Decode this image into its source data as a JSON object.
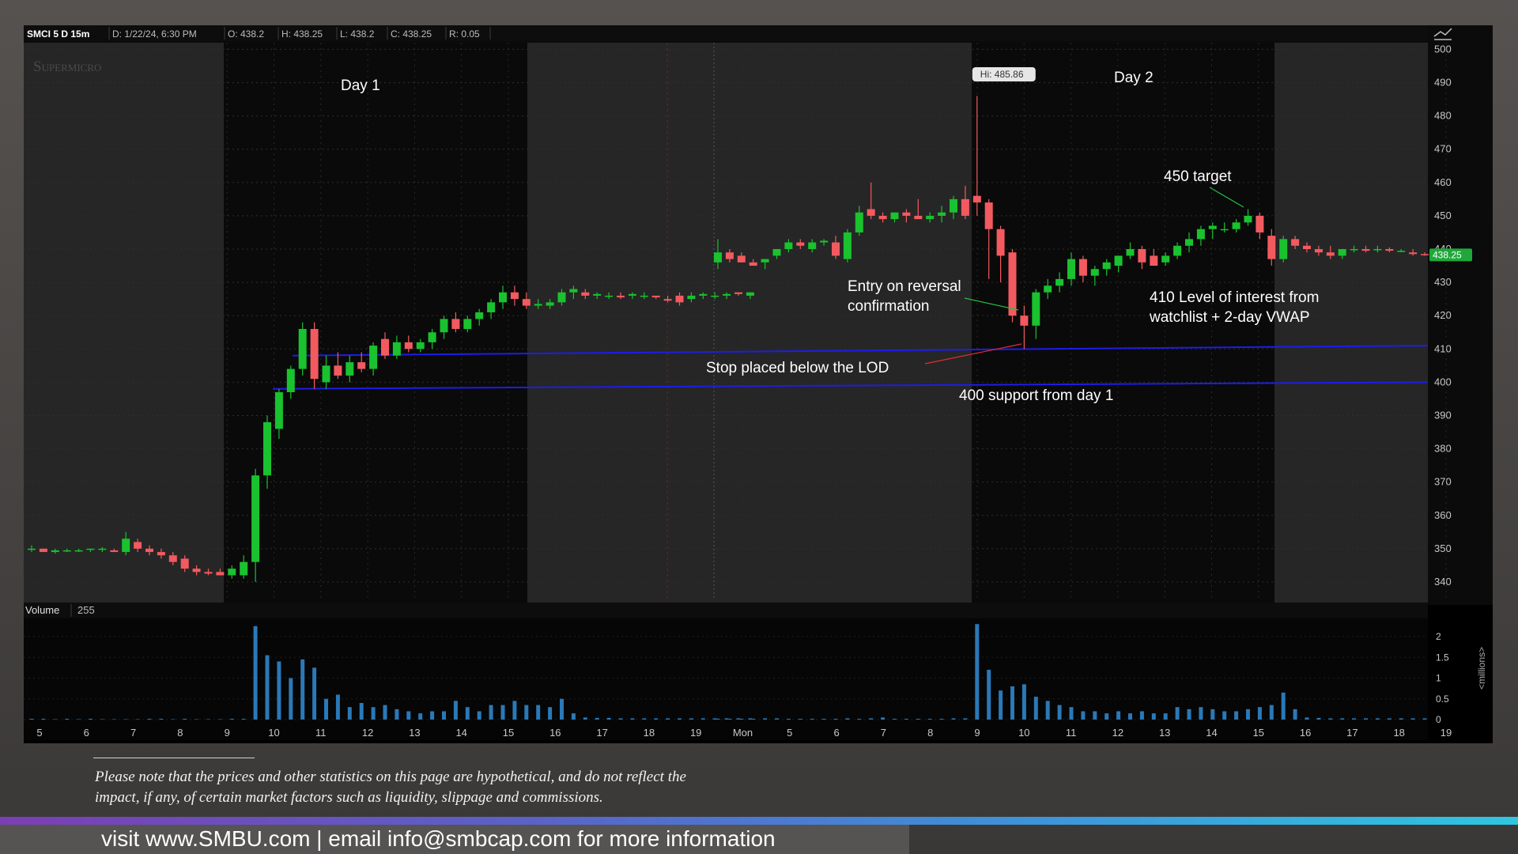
{
  "header": {
    "symbol": "SMCI 5 D 15m",
    "date": "D: 1/22/24, 6:30 PM",
    "open": "O: 438.2",
    "high": "H: 438.25",
    "low": "L: 438.2",
    "close": "C: 438.25",
    "range": "R: 0.05"
  },
  "watermark": "Supermicro",
  "volume_header": {
    "label": "Volume",
    "value": "255"
  },
  "chart_data": {
    "type": "candlestick",
    "ylim": [
      335,
      502
    ],
    "y_ticks": [
      340,
      350,
      360,
      370,
      380,
      390,
      400,
      410,
      420,
      430,
      440,
      450,
      460,
      470,
      480,
      490,
      500
    ],
    "x_ticks": [
      "5",
      "6",
      "7",
      "8",
      "9",
      "10",
      "11",
      "12",
      "13",
      "14",
      "15",
      "16",
      "17",
      "18",
      "19",
      "Mon",
      "5",
      "6",
      "7",
      "8",
      "9",
      "10",
      "11",
      "12",
      "13",
      "14",
      "15",
      "16",
      "17",
      "18",
      "19"
    ],
    "price_tag": "438.25",
    "high_tag": "Hi: 485.86",
    "hlines": [
      {
        "label": "410",
        "y_start": 408,
        "y_end": 411
      },
      {
        "label": "400",
        "y_start": 398,
        "y_end": 400
      }
    ],
    "day1": [
      {
        "o": 350,
        "h": 351,
        "l": 349,
        "c": 350
      },
      {
        "o": 350,
        "h": 350,
        "l": 349,
        "c": 349
      },
      {
        "o": 349,
        "h": 350,
        "l": 348.5,
        "c": 349.5
      },
      {
        "o": 349.5,
        "h": 350,
        "l": 349,
        "c": 349.5
      },
      {
        "o": 349.5,
        "h": 350,
        "l": 349,
        "c": 349.5
      },
      {
        "o": 350,
        "h": 350,
        "l": 349,
        "c": 350
      },
      {
        "o": 350,
        "h": 350.5,
        "l": 349,
        "c": 350
      },
      {
        "o": 349.5,
        "h": 350,
        "l": 349,
        "c": 349
      },
      {
        "o": 349,
        "h": 355,
        "l": 348,
        "c": 353
      },
      {
        "o": 352,
        "h": 353,
        "l": 349,
        "c": 350
      },
      {
        "o": 350,
        "h": 351,
        "l": 348,
        "c": 349
      },
      {
        "o": 349,
        "h": 350,
        "l": 347,
        "c": 348
      },
      {
        "o": 348,
        "h": 349,
        "l": 345,
        "c": 346
      },
      {
        "o": 347,
        "h": 348,
        "l": 343,
        "c": 344
      },
      {
        "o": 344,
        "h": 345,
        "l": 342,
        "c": 343
      },
      {
        "o": 343,
        "h": 344,
        "l": 342,
        "c": 342.5
      },
      {
        "o": 343,
        "h": 344,
        "l": 342,
        "c": 342
      },
      {
        "o": 342,
        "h": 345,
        "l": 341,
        "c": 344
      },
      {
        "o": 342,
        "h": 348,
        "l": 341,
        "c": 346
      },
      {
        "o": 346,
        "h": 374,
        "l": 340,
        "c": 372
      },
      {
        "o": 372,
        "h": 390,
        "l": 368,
        "c": 388
      },
      {
        "o": 386,
        "h": 398,
        "l": 383,
        "c": 397
      },
      {
        "o": 397,
        "h": 405,
        "l": 395,
        "c": 404
      },
      {
        "o": 404,
        "h": 418,
        "l": 402,
        "c": 416
      },
      {
        "o": 416,
        "h": 418,
        "l": 398,
        "c": 401
      },
      {
        "o": 400,
        "h": 408,
        "l": 398,
        "c": 405
      },
      {
        "o": 405,
        "h": 409,
        "l": 401,
        "c": 402
      },
      {
        "o": 402,
        "h": 408,
        "l": 400,
        "c": 406
      },
      {
        "o": 406,
        "h": 409,
        "l": 403,
        "c": 404
      },
      {
        "o": 404,
        "h": 412,
        "l": 402,
        "c": 411
      },
      {
        "o": 413,
        "h": 415,
        "l": 407,
        "c": 408
      },
      {
        "o": 408,
        "h": 414,
        "l": 407,
        "c": 412
      },
      {
        "o": 412,
        "h": 414,
        "l": 409,
        "c": 410
      },
      {
        "o": 410,
        "h": 413,
        "l": 409,
        "c": 412
      },
      {
        "o": 412,
        "h": 416,
        "l": 410,
        "c": 415
      },
      {
        "o": 415,
        "h": 420,
        "l": 413,
        "c": 419
      },
      {
        "o": 419,
        "h": 421,
        "l": 415,
        "c": 416
      },
      {
        "o": 416,
        "h": 420,
        "l": 415,
        "c": 419
      },
      {
        "o": 419,
        "h": 422,
        "l": 417,
        "c": 421
      },
      {
        "o": 421,
        "h": 425,
        "l": 419,
        "c": 424
      },
      {
        "o": 424,
        "h": 429,
        "l": 422,
        "c": 427
      },
      {
        "o": 427,
        "h": 429,
        "l": 423,
        "c": 425
      },
      {
        "o": 425,
        "h": 427,
        "l": 422,
        "c": 423
      },
      {
        "o": 423,
        "h": 425,
        "l": 422,
        "c": 423.5
      },
      {
        "o": 423,
        "h": 425,
        "l": 422,
        "c": 424
      },
      {
        "o": 424,
        "h": 428,
        "l": 423,
        "c": 427
      },
      {
        "o": 427,
        "h": 429,
        "l": 425,
        "c": 428
      },
      {
        "o": 427,
        "h": 428,
        "l": 425,
        "c": 426
      },
      {
        "o": 426,
        "h": 427,
        "l": 425,
        "c": 426.5
      },
      {
        "o": 426,
        "h": 427,
        "l": 425,
        "c": 426
      },
      {
        "o": 426,
        "h": 427,
        "l": 425,
        "c": 425.5
      },
      {
        "o": 426,
        "h": 427,
        "l": 425,
        "c": 426.5
      },
      {
        "o": 426,
        "h": 427,
        "l": 425,
        "c": 426
      },
      {
        "o": 426,
        "h": 426,
        "l": 425,
        "c": 425.5
      },
      {
        "o": 425,
        "h": 426,
        "l": 424,
        "c": 424.5
      },
      {
        "o": 426,
        "h": 427,
        "l": 423,
        "c": 424
      },
      {
        "o": 425,
        "h": 427,
        "l": 424,
        "c": 426
      },
      {
        "o": 426,
        "h": 427,
        "l": 425,
        "c": 426.5
      },
      {
        "o": 426,
        "h": 427,
        "l": 425,
        "c": 426
      },
      {
        "o": 426,
        "h": 427,
        "l": 425,
        "c": 426.5
      },
      {
        "o": 427,
        "h": 427,
        "l": 426,
        "c": 426.5
      },
      {
        "o": 426,
        "h": 427,
        "l": 425,
        "c": 427
      }
    ],
    "day2": [
      {
        "o": 436,
        "h": 443,
        "l": 434,
        "c": 439
      },
      {
        "o": 439,
        "h": 440,
        "l": 436,
        "c": 437
      },
      {
        "o": 438,
        "h": 439,
        "l": 436,
        "c": 436
      },
      {
        "o": 436,
        "h": 437,
        "l": 435,
        "c": 435
      },
      {
        "o": 436,
        "h": 437,
        "l": 434,
        "c": 437
      },
      {
        "o": 438,
        "h": 440,
        "l": 437,
        "c": 440
      },
      {
        "o": 440,
        "h": 443,
        "l": 439,
        "c": 442
      },
      {
        "o": 442,
        "h": 443,
        "l": 440,
        "c": 441
      },
      {
        "o": 440,
        "h": 443,
        "l": 439,
        "c": 442
      },
      {
        "o": 442,
        "h": 443,
        "l": 441,
        "c": 442.5
      },
      {
        "o": 442,
        "h": 444,
        "l": 437,
        "c": 438
      },
      {
        "o": 437,
        "h": 446,
        "l": 436,
        "c": 445
      },
      {
        "o": 445,
        "h": 453,
        "l": 444,
        "c": 451
      },
      {
        "o": 452,
        "h": 460,
        "l": 449,
        "c": 450
      },
      {
        "o": 450,
        "h": 451,
        "l": 448,
        "c": 449
      },
      {
        "o": 449,
        "h": 451,
        "l": 448,
        "c": 451
      },
      {
        "o": 451,
        "h": 452,
        "l": 448,
        "c": 450
      },
      {
        "o": 450,
        "h": 455,
        "l": 449,
        "c": 449
      },
      {
        "o": 449,
        "h": 451,
        "l": 448,
        "c": 450
      },
      {
        "o": 450,
        "h": 453,
        "l": 448,
        "c": 451
      },
      {
        "o": 451,
        "h": 456,
        "l": 449,
        "c": 455
      },
      {
        "o": 455,
        "h": 459,
        "l": 449,
        "c": 450
      },
      {
        "o": 456,
        "h": 486,
        "l": 450,
        "c": 454
      },
      {
        "o": 454,
        "h": 455,
        "l": 431,
        "c": 446
      },
      {
        "o": 446,
        "h": 447,
        "l": 430,
        "c": 438
      },
      {
        "o": 439,
        "h": 440,
        "l": 418,
        "c": 420
      },
      {
        "o": 420,
        "h": 423,
        "l": 410,
        "c": 417
      },
      {
        "o": 417,
        "h": 428,
        "l": 413,
        "c": 427
      },
      {
        "o": 427,
        "h": 431,
        "l": 425,
        "c": 429
      },
      {
        "o": 429,
        "h": 433,
        "l": 427,
        "c": 431
      },
      {
        "o": 431,
        "h": 439,
        "l": 429,
        "c": 437
      },
      {
        "o": 437,
        "h": 438,
        "l": 430,
        "c": 432
      },
      {
        "o": 432,
        "h": 435,
        "l": 429,
        "c": 434
      },
      {
        "o": 434,
        "h": 437,
        "l": 432,
        "c": 436
      },
      {
        "o": 435,
        "h": 438,
        "l": 433,
        "c": 438
      },
      {
        "o": 438,
        "h": 442,
        "l": 437,
        "c": 440
      },
      {
        "o": 440,
        "h": 441,
        "l": 434,
        "c": 436
      },
      {
        "o": 438,
        "h": 440,
        "l": 435,
        "c": 435
      },
      {
        "o": 436,
        "h": 439,
        "l": 435,
        "c": 438
      },
      {
        "o": 438,
        "h": 442,
        "l": 437,
        "c": 441
      },
      {
        "o": 441,
        "h": 445,
        "l": 439,
        "c": 443
      },
      {
        "o": 443,
        "h": 447,
        "l": 441,
        "c": 446
      },
      {
        "o": 446,
        "h": 448,
        "l": 443,
        "c": 447
      },
      {
        "o": 446,
        "h": 448,
        "l": 445,
        "c": 446
      },
      {
        "o": 446,
        "h": 449,
        "l": 445,
        "c": 448
      },
      {
        "o": 448,
        "h": 452,
        "l": 447,
        "c": 450
      },
      {
        "o": 450,
        "h": 451,
        "l": 443,
        "c": 445
      },
      {
        "o": 444,
        "h": 446,
        "l": 435,
        "c": 437
      },
      {
        "o": 437,
        "h": 444,
        "l": 436,
        "c": 443
      },
      {
        "o": 443,
        "h": 444,
        "l": 440,
        "c": 441
      },
      {
        "o": 441,
        "h": 442,
        "l": 439,
        "c": 440
      },
      {
        "o": 440,
        "h": 441,
        "l": 438,
        "c": 439
      },
      {
        "o": 439,
        "h": 441,
        "l": 437,
        "c": 438
      },
      {
        "o": 438,
        "h": 440,
        "l": 437,
        "c": 440
      },
      {
        "o": 440,
        "h": 441,
        "l": 439,
        "c": 440
      },
      {
        "o": 440,
        "h": 441,
        "l": 439,
        "c": 439.5
      },
      {
        "o": 440,
        "h": 441,
        "l": 439,
        "c": 440
      },
      {
        "o": 440,
        "h": 440.5,
        "l": 439,
        "c": 439.5
      },
      {
        "o": 439.5,
        "h": 440,
        "l": 439,
        "c": 439.5
      },
      {
        "o": 439,
        "h": 440,
        "l": 438,
        "c": 438.5
      },
      {
        "o": 438.5,
        "h": 439,
        "l": 438,
        "c": 438.25
      }
    ],
    "volume": {
      "ylim": [
        0,
        2.4
      ],
      "y_ticks": [
        "2",
        "1.5",
        "1",
        "0.5",
        "0"
      ],
      "day1": [
        0.02,
        0.02,
        0.01,
        0.02,
        0.01,
        0.02,
        0.01,
        0.01,
        0.01,
        0.01,
        0.02,
        0.02,
        0.01,
        0.02,
        0.01,
        0.01,
        0.01,
        0.02,
        0.02,
        2.25,
        1.55,
        1.4,
        1.0,
        1.45,
        1.25,
        0.5,
        0.6,
        0.3,
        0.4,
        0.3,
        0.35,
        0.25,
        0.2,
        0.15,
        0.2,
        0.2,
        0.45,
        0.3,
        0.2,
        0.35,
        0.35,
        0.45,
        0.35,
        0.35,
        0.3,
        0.5,
        0.15,
        0.05,
        0.04,
        0.04,
        0.03,
        0.03,
        0.03,
        0.03,
        0.03,
        0.03,
        0.03,
        0.03,
        0.03,
        0.03,
        0.03,
        0.03
      ],
      "day2": [
        0.02,
        0.02,
        0.02,
        0.02,
        0.03,
        0.03,
        0.02,
        0.02,
        0.02,
        0.02,
        0.02,
        0.03,
        0.02,
        0.03,
        0.05,
        0.02,
        0.02,
        0.02,
        0.02,
        0.02,
        0.03,
        0.03,
        2.3,
        1.2,
        0.7,
        0.8,
        0.85,
        0.55,
        0.45,
        0.35,
        0.3,
        0.2,
        0.2,
        0.15,
        0.2,
        0.15,
        0.2,
        0.15,
        0.15,
        0.3,
        0.25,
        0.3,
        0.25,
        0.2,
        0.2,
        0.25,
        0.3,
        0.35,
        0.65,
        0.25,
        0.05,
        0.04,
        0.03,
        0.03,
        0.03,
        0.03,
        0.03,
        0.03,
        0.03,
        0.03,
        0.03
      ]
    },
    "annotations": {
      "day1": "Day 1",
      "day2": "Day 2",
      "entry": [
        "Entry on reversal",
        "confirmation"
      ],
      "stop": "Stop placed  below the LOD",
      "support400": "400 support from day 1",
      "level410": [
        "410 Level of interest from",
        "watchlist + 2-day VWAP"
      ],
      "target450": "450 target"
    },
    "volume_axis_label": "<millions>"
  },
  "disclaimer": {
    "line1": "Please note that the prices and other statistics on this page are hypothetical, and do not reflect the",
    "line2": "impact, if any, of certain market factors such as liquidity, slippage and commissions."
  },
  "footer_text": "visit www.SMBU.com | email info@smbcap.com for more information",
  "colors": {
    "up": "#19c22e",
    "down": "#f25a60",
    "grid": "#2f2f2f",
    "hline": "#1d1de8",
    "volume": "#2a79b8",
    "premarket": "#262626",
    "regular": "#0a0a0a",
    "price_tag": "#1fa83a"
  }
}
